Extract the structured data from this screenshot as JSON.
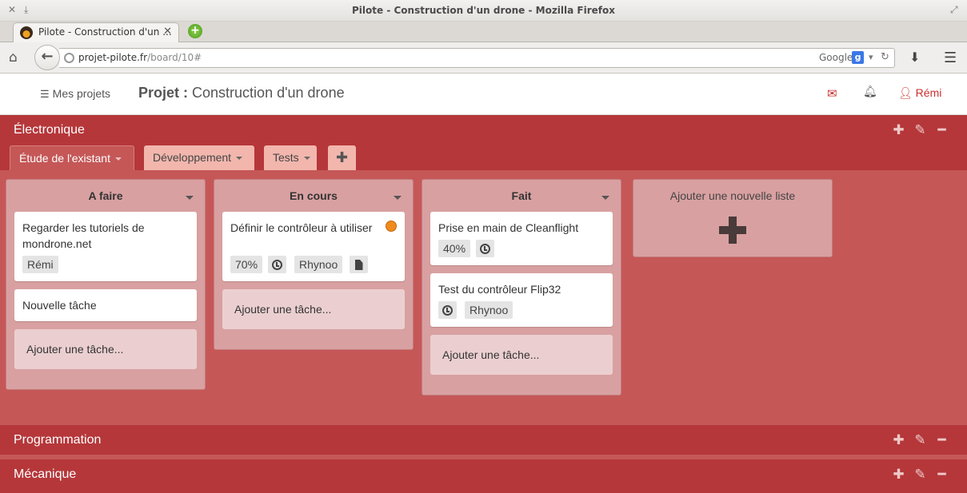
{
  "window": {
    "title": "Pilote - Construction d'un drone - Mozilla Firefox"
  },
  "browser": {
    "tab_title": "Pilote - Construction d'un ...",
    "url_host": "projet-pilote.fr",
    "url_path": "/board/10#",
    "search_engine": "Google",
    "search_badge": "g"
  },
  "header": {
    "my_projects": "Mes projets",
    "project_label": "Projet :",
    "project_name": "Construction d'un drone",
    "user": "Rémi"
  },
  "categories": [
    {
      "name": "Électronique",
      "expanded": true,
      "subtabs": [
        {
          "label": "Étude de l'existant",
          "active": true
        },
        {
          "label": "Développement",
          "active": false
        },
        {
          "label": "Tests",
          "active": false
        }
      ]
    },
    {
      "name": "Programmation",
      "expanded": false
    },
    {
      "name": "Mécanique",
      "expanded": false
    }
  ],
  "board": {
    "columns": [
      {
        "title": "A faire",
        "cards": [
          {
            "title": "Regarder les tutoriels de mondrone.net",
            "tags": [
              "Rémi"
            ]
          },
          {
            "title": "Nouvelle tâche",
            "tags": []
          }
        ],
        "add_task": "Ajouter une tâche..."
      },
      {
        "title": "En cours",
        "cards": [
          {
            "title": "Définir le contrôleur à utiliser",
            "progress": "70%",
            "assignee": "Rhynoo",
            "status_color": "#f08a1c"
          }
        ],
        "add_task": "Ajouter une tâche..."
      },
      {
        "title": "Fait",
        "cards": [
          {
            "title": "Prise en main de Cleanflight",
            "progress": "40%"
          },
          {
            "title": "Test du contrôleur Flip32",
            "assignee": "Rhynoo"
          }
        ],
        "add_task": "Ajouter une tâche..."
      }
    ],
    "add_list": "Ajouter une nouvelle liste"
  },
  "colors": {
    "category_band": "#b5373a",
    "board_bg": "#c55757",
    "accent_red": "#c9302c"
  }
}
